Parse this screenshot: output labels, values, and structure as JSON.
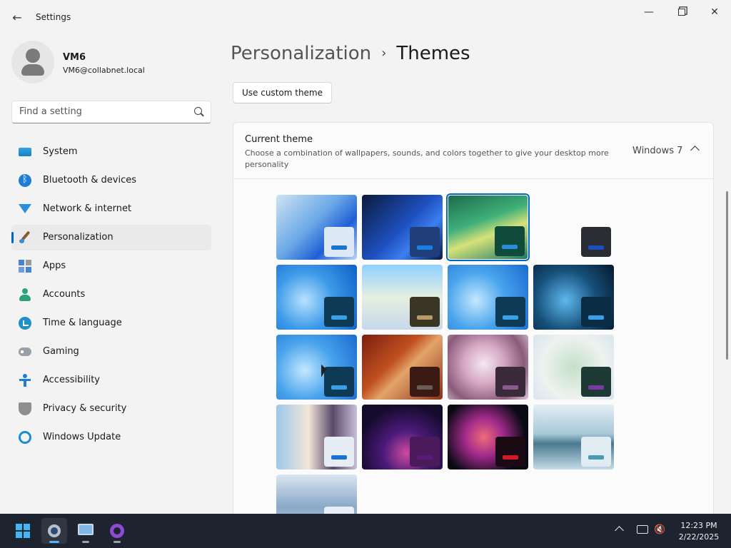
{
  "window": {
    "title": "Settings",
    "back_icon": "arrow-left-icon",
    "controls": [
      "minimize-icon",
      "restore-icon",
      "close-icon"
    ]
  },
  "profile": {
    "name": "VM6",
    "email": "VM6@collabnet.local"
  },
  "search": {
    "placeholder": "Find a setting",
    "value": ""
  },
  "nav": {
    "items": [
      {
        "label": "System",
        "icon": "monitor-icon"
      },
      {
        "label": "Bluetooth & devices",
        "icon": "bluetooth-icon"
      },
      {
        "label": "Network & internet",
        "icon": "wifi-icon"
      },
      {
        "label": "Personalization",
        "icon": "paintbrush-icon",
        "active": true
      },
      {
        "label": "Apps",
        "icon": "apps-grid-icon"
      },
      {
        "label": "Accounts",
        "icon": "person-icon"
      },
      {
        "label": "Time & language",
        "icon": "clock-globe-icon"
      },
      {
        "label": "Gaming",
        "icon": "gamepad-icon"
      },
      {
        "label": "Accessibility",
        "icon": "accessibility-icon"
      },
      {
        "label": "Privacy & security",
        "icon": "shield-icon"
      },
      {
        "label": "Windows Update",
        "icon": "refresh-icon"
      }
    ]
  },
  "breadcrumb": {
    "parent": "Personalization",
    "separator": "›",
    "current": "Themes"
  },
  "actions": {
    "custom_theme_label": "Use custom theme"
  },
  "current_theme": {
    "title": "Current theme",
    "description": "Choose a combination of wallpapers, sounds, and colors together to give your desktop more personality",
    "value": "Windows 7"
  },
  "themes": [
    {
      "bg": "linear-gradient(135deg,#cfe3f5 0%,#6aa8e6 45%,#1f5fd6 70%,#bcd6f1 100%)",
      "swatch": "#dde9f5",
      "accent": "#1a73d0"
    },
    {
      "bg": "linear-gradient(135deg,#0a1a3c 0%,#1f4fbf 50%,#3c7ff0 70%,#0b1840 100%)",
      "swatch": "#1f3e7a",
      "accent": "#1a80e0"
    },
    {
      "bg": "linear-gradient(160deg,#1c6a4a 0%,#3fb07a 40%,#d6e27a 60%,#1e7a66 100%)",
      "swatch": "#0f4a3a",
      "accent": "#2a8ee0",
      "selected": true
    },
    {
      "bg": "transparent",
      "swatch": "#2a2d33",
      "accent": "#1a4fc0"
    },
    {
      "bg": "radial-gradient(circle at 35% 55%,#b8e2ff 0%,#3d9ae8 45%,#0d5fc8 100%)",
      "swatch": "#0f3a55",
      "accent": "#3aa0e6"
    },
    {
      "bg": "linear-gradient(180deg,#8fd0ff 0%,#e6efe0 50%,#c6d8ea 100%)",
      "swatch": "#3a3626",
      "accent": "#b89a66"
    },
    {
      "bg": "radial-gradient(circle at 35% 55%,#c4e8ff 0%,#4aa4ec 45%,#1a6ad0 100%)",
      "swatch": "#0f3a55",
      "accent": "#3aa0e6"
    },
    {
      "bg": "radial-gradient(circle at 40% 55%,#5fb8ee 0%,#16507a 50%,#06182c 100%)",
      "swatch": "#0a2d45",
      "accent": "#3aa0e6"
    },
    {
      "bg": "radial-gradient(circle at 35% 55%,#c4e8ff 0%,#4aa4ec 45%,#1a6ad0 100%)",
      "swatch": "#0f3a55",
      "accent": "#3aa0e6"
    },
    {
      "bg": "linear-gradient(135deg,#7a1e10 0%,#c0501f 40%,#e3a46a 55%,#8a2e16 100%)",
      "swatch": "#3a1a12",
      "accent": "#6a5a58"
    },
    {
      "bg": "radial-gradient(circle at 45% 45%,#f4e9f2 0%,#d6a8c4 35%,#8a5a7a 70%,#d8c8d4 100%)",
      "swatch": "#3a2a3a",
      "accent": "#8a5a90"
    },
    {
      "bg": "radial-gradient(circle at 50% 50%,#c4e0c8 0%,#eef2f0 60%,#d8e4ee 100%)",
      "swatch": "#1e3a34",
      "accent": "#7a3aa6"
    },
    {
      "bg": "linear-gradient(90deg,#9cc8ea 0%,#f2e6d8 40%,#5a4a6a 70%,#c8c0d8 100%)",
      "swatch": "#e6edf5",
      "accent": "#1a73d0"
    },
    {
      "bg": "radial-gradient(circle at 55% 75%,#d04aa0 0%,#4a1a7a 35%,#140a2a 75%)",
      "swatch": "#4a1a5a",
      "accent": "#5a1a7a"
    },
    {
      "bg": "radial-gradient(circle at 45% 50%,#f06a7a 0%,#a02a8a 35%,#0a0a14 75%)",
      "swatch": "#1a0a14",
      "accent": "#d01a2a"
    },
    {
      "bg": "linear-gradient(180deg,#e4eef4 0%,#a8c8d8 45%,#4a7a90 60%,#c4dce8 100%)",
      "swatch": "#e0ecf2",
      "accent": "#4a9ab0"
    },
    {
      "bg": "linear-gradient(180deg,#dae6f0 0%,#8aa8c8 50%,#c8d8e8 100%)",
      "swatch": "#e8eef5",
      "accent": "#6a8ab0"
    }
  ],
  "taskbar": {
    "apps": [
      {
        "name": "start",
        "icon": "windows-start-icon"
      },
      {
        "name": "settings",
        "icon": "settings-gear-icon",
        "active": true
      },
      {
        "name": "remote-desktop",
        "icon": "remote-desktop-icon"
      },
      {
        "name": "github-desktop",
        "icon": "github-icon"
      }
    ],
    "tray": {
      "time": "12:23 PM",
      "date": "2/22/2025",
      "volume_glyph": "🔇"
    }
  }
}
